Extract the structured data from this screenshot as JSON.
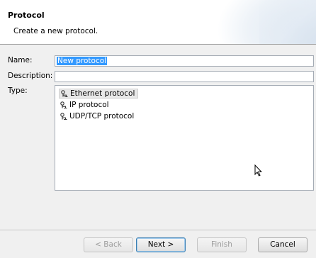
{
  "banner": {
    "title": "Protocol",
    "message": "Create a new protocol."
  },
  "form": {
    "name_label": "Name:",
    "name_value": "New protocol",
    "description_label": "Description:",
    "description_value": "",
    "type_label": "Type:"
  },
  "types": [
    {
      "label": "Ethernet protocol",
      "icon": "protocol-icon",
      "selected": true
    },
    {
      "label": "IP protocol",
      "icon": "protocol-icon",
      "selected": false
    },
    {
      "label": "UDP/TCP protocol",
      "icon": "protocol-icon",
      "selected": false
    }
  ],
  "buttons": {
    "back": "< Back",
    "next": "Next >",
    "finish": "Finish",
    "cancel": "Cancel"
  }
}
